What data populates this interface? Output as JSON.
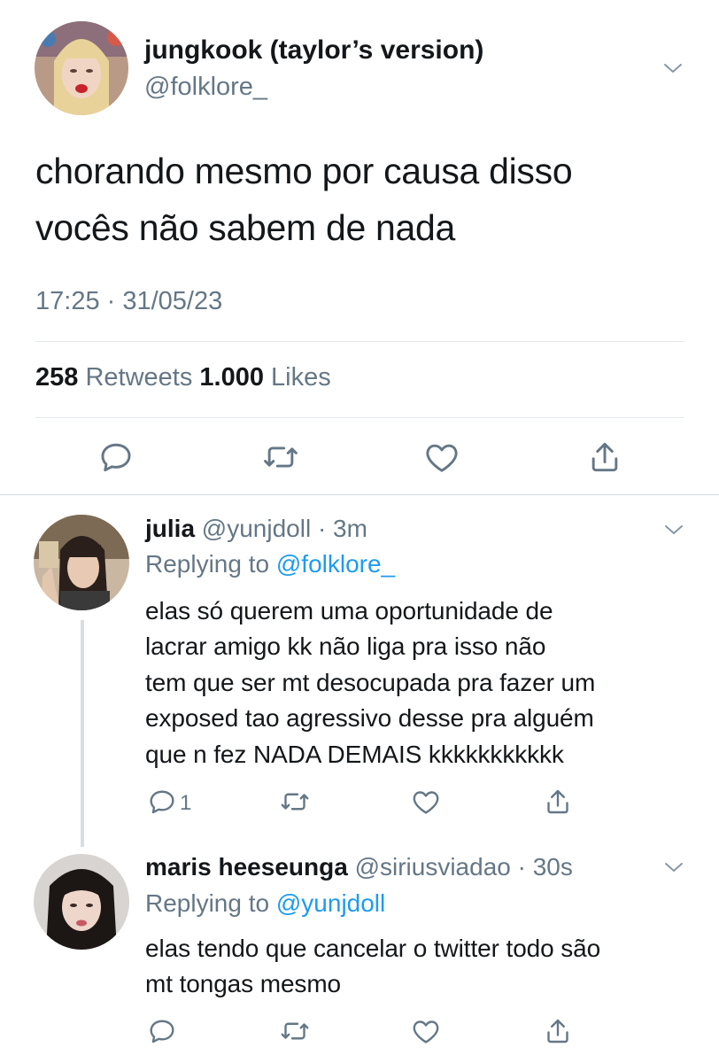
{
  "main_tweet": {
    "display_name": "jungkook (taylor’s version)",
    "handle": "@folklore_",
    "text_lines": [
      "chorando mesmo por causa disso",
      "vocês não sabem de nada"
    ],
    "timestamp": "17:25 · 31/05/23",
    "retweets_count": "258",
    "retweets_label": "Retweets",
    "likes_count": "1.000",
    "likes_label": "Likes",
    "actions": [
      "reply-icon",
      "retweet-icon",
      "like-icon",
      "share-icon"
    ]
  },
  "replies": [
    {
      "display_name": "julia",
      "handle": "@yunjdoll",
      "time": "· 3m",
      "replying_prefix": "Replying to",
      "replying_to": "@folklore_",
      "text_lines": [
        "elas só querem uma oportunidade de",
        "lacrar amigo kk não liga pra isso não",
        "tem que ser mt desocupada pra fazer um",
        "exposed tao agressivo desse pra alguém",
        "que n fez NADA DEMAIS kkkkkkkkkkk"
      ],
      "reply_count": "1"
    },
    {
      "display_name": "maris heeseunga",
      "handle": "@siriusviadao",
      "time": "· 30s",
      "replying_prefix": "Replying to",
      "replying_to": "@yunjdoll",
      "text_lines": [
        "elas tendo que cancelar o twitter todo são",
        "mt tongas mesmo"
      ]
    }
  ],
  "colors": {
    "text": "#14171a",
    "secondary": "#657786",
    "link": "#1d9bf0",
    "divider": "#e1e8ed"
  }
}
